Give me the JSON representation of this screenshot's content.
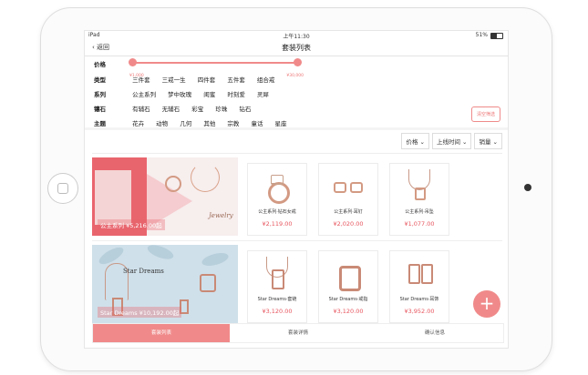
{
  "status_bar": {
    "carrier": "iPad",
    "time": "上午11:30",
    "battery": "51%"
  },
  "nav": {
    "back_label": "返回",
    "title": "套装列表"
  },
  "filters": {
    "price": {
      "label": "价格",
      "min": "¥1,000",
      "max": "¥30,000"
    },
    "rows": [
      {
        "label": "类型",
        "options": [
          "三件套",
          "三戒一生",
          "四件套",
          "五件套",
          "组合戒"
        ]
      },
      {
        "label": "系列",
        "options": [
          "公主系列",
          "梦中玫瑰",
          "闺蜜",
          "时刻爱",
          "灵犀"
        ]
      },
      {
        "label": "镶石",
        "options": [
          "有辅石",
          "无辅石",
          "彩宝",
          "珍珠",
          "钻石"
        ]
      },
      {
        "label": "主题",
        "options": [
          "花卉",
          "动物",
          "几何",
          "其他",
          "宗教",
          "童话",
          "星座"
        ]
      }
    ],
    "clear_label": "清空筛选"
  },
  "sort": {
    "price": "价格 ⌄",
    "launch": "上线时间 ⌄",
    "sales": "销量 ⌄"
  },
  "sets": [
    {
      "banner_caption": "公主系列  ¥5,216.00起",
      "banner_script": "Jewelry",
      "products": [
        {
          "name": "公主系列·钻石女戒",
          "price": "¥2,119.00"
        },
        {
          "name": "公主系列·耳钉",
          "price": "¥2,020.00"
        },
        {
          "name": "公主系列·吊坠",
          "price": "¥1,077.00"
        }
      ]
    },
    {
      "banner_caption": "Star Dreams  ¥10,192.00起",
      "banner_title": "Star Dreams",
      "products": [
        {
          "name": "Star Dreams·套链",
          "price": "¥3,120.00"
        },
        {
          "name": "Star Dreams·戒指",
          "price": "¥3,120.00"
        },
        {
          "name": "Star Dreams·耳饰",
          "price": "¥3,952.00"
        }
      ]
    }
  ],
  "fab_label": "+",
  "bottom_tabs": [
    "套装列表",
    "套装详情",
    "确认信息"
  ],
  "colors": {
    "accent": "#f08a8a",
    "price": "#e7555e"
  }
}
